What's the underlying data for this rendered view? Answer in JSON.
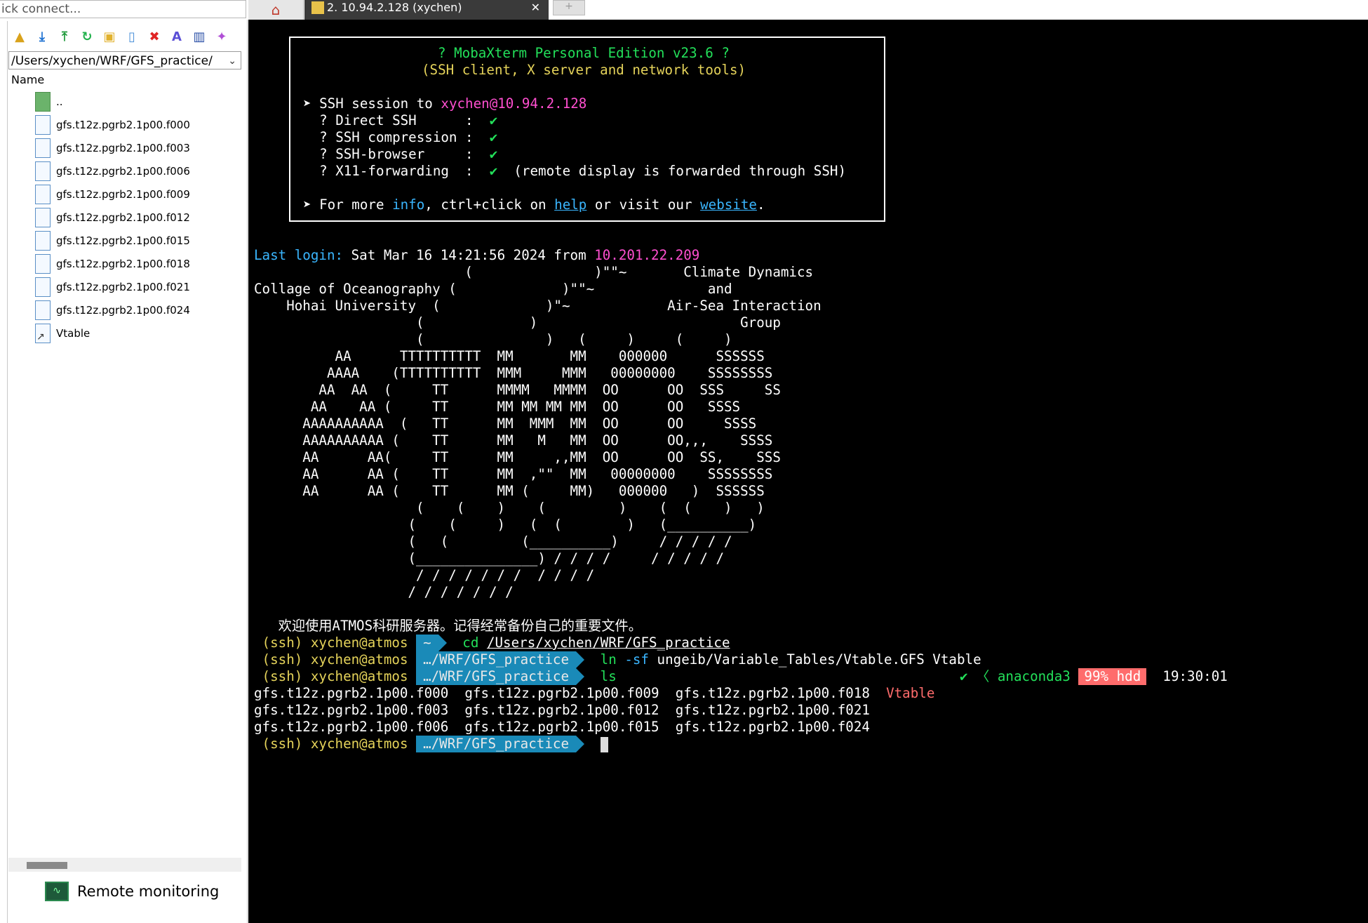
{
  "quick_connect": {
    "placeholder": "ick connect..."
  },
  "toolbar": {
    "icons": [
      "parent-folder-icon",
      "download-icon",
      "upload-icon",
      "refresh-icon",
      "new-folder-icon",
      "new-file-icon",
      "delete-icon",
      "rename-icon",
      "toggle-hidden-icon",
      "magic-wand-icon"
    ]
  },
  "file_browser": {
    "path": "/Users/xychen/WRF/GFS_practice/",
    "column_name": "Name",
    "items": [
      {
        "name": "..",
        "type": "up"
      },
      {
        "name": "gfs.t12z.pgrb2.1p00.f000",
        "type": "file"
      },
      {
        "name": "gfs.t12z.pgrb2.1p00.f003",
        "type": "file"
      },
      {
        "name": "gfs.t12z.pgrb2.1p00.f006",
        "type": "file"
      },
      {
        "name": "gfs.t12z.pgrb2.1p00.f009",
        "type": "file"
      },
      {
        "name": "gfs.t12z.pgrb2.1p00.f012",
        "type": "file"
      },
      {
        "name": "gfs.t12z.pgrb2.1p00.f015",
        "type": "file"
      },
      {
        "name": "gfs.t12z.pgrb2.1p00.f018",
        "type": "file"
      },
      {
        "name": "gfs.t12z.pgrb2.1p00.f021",
        "type": "file"
      },
      {
        "name": "gfs.t12z.pgrb2.1p00.f024",
        "type": "file"
      },
      {
        "name": "Vtable",
        "type": "link"
      }
    ]
  },
  "remote_monitoring": "Remote monitoring",
  "tabs": {
    "session_label": "2. 10.94.2.128 (xychen)",
    "close": "✕",
    "new_tab": "+"
  },
  "banner": {
    "line1": "? MobaXterm Personal Edition v23.6 ?",
    "line2": "(SSH client, X server and network tools)",
    "session_prefix": "➤ SSH session to ",
    "session_target": "xychen@10.94.2.128",
    "direct_ssh": "  ? Direct SSH      :  ",
    "compression": "  ? SSH compression :  ",
    "browser": "  ? SSH-browser     :  ",
    "x11": "  ? X11-forwarding  :  ",
    "check": "✔",
    "x11_note": "  (remote display is forwarded through SSH)",
    "info_prefix": "➤ For more ",
    "info": "info",
    "info_mid": ", ctrl+click on ",
    "help": "help",
    "info_mid2": " or visit our ",
    "website": "website",
    "info_end": "."
  },
  "last_login": {
    "label": "Last login:",
    "text": " Sat Mar 16 14:21:56 2024 from ",
    "ip": "10.201.22.209"
  },
  "ascii_art": [
    "                          (               )\"\"~       Climate Dynamics",
    "Collage of Oceanography (             )\"\"~              and",
    "    Hohai University  (             )\"~            Air-Sea Interaction",
    "                    (             )                         Group",
    "                    (               )   (     )     (     )",
    "          AA      TTTTTTTTTT  MM       MM    000000      SSSSSS",
    "         AAAA    (TTTTTTTTTT  MMM     MMM   00000000    SSSSSSSS",
    "        AA  AA  (     TT      MMMM   MMMM  OO      OO  SSS     SS",
    "       AA    AA (     TT      MM MM MM MM  OO      OO   SSSS",
    "      AAAAAAAAAA  (   TT      MM  MMM  MM  OO      OO     SSSS",
    "      AAAAAAAAAA (    TT      MM   M   MM  OO      OO,,,    SSSS",
    "      AA      AA(     TT      MM     ,,MM  OO      OO  SS,    SSS",
    "      AA      AA (    TT      MM  ,\"\"  MM   00000000    SSSSSSSS",
    "      AA      AA (    TT      MM (     MM)   000000   )  SSSSSS",
    "                    (    (    )    (         )    (  (    )   )",
    "                   (    (     )   (  (        )   (__________)",
    "                   (   (         (__________)     / / / / /",
    "                   (_______________) / / / /     / / / / /",
    "                    / / / / / / /  / / / /",
    "                   / / / / / / /"
  ],
  "welcome": "   欢迎使用ATMOS科研服务器。记得经常备份自己的重要文件。",
  "prompt": {
    "env": " (ssh) ",
    "user": "xychen@atmos",
    "home": "~",
    "dir": "…/WRF/GFS_practice"
  },
  "commands": {
    "cmd1_name": "cd",
    "cmd1_arg": "/Users/xychen/WRF/GFS_practice",
    "cmd2_name": "ln",
    "cmd2_flag": "-sf",
    "cmd2_args": "ungeib/Variable_Tables/Vtable.GFS Vtable",
    "cmd3_name": "ls"
  },
  "status": {
    "check": "✔",
    "angle": "〈",
    "env": "anaconda3",
    "hdd": "99% hdd",
    "time": "19:30:01"
  },
  "ls_output": [
    [
      "gfs.t12z.pgrb2.1p00.f000",
      "gfs.t12z.pgrb2.1p00.f009",
      "gfs.t12z.pgrb2.1p00.f018",
      "Vtable"
    ],
    [
      "gfs.t12z.pgrb2.1p00.f003",
      "gfs.t12z.pgrb2.1p00.f012",
      "gfs.t12z.pgrb2.1p00.f021"
    ],
    [
      "gfs.t12z.pgrb2.1p00.f006",
      "gfs.t12z.pgrb2.1p00.f015",
      "gfs.t12z.pgrb2.1p00.f024"
    ]
  ],
  "colors": {
    "green": "#23e05a",
    "yellow": "#e5d35a",
    "magenta": "#ff4fd0",
    "cyan": "#3ab6ff",
    "prompt_bg": "#1a8ab8",
    "hdd_bg": "#ff6c6c"
  }
}
